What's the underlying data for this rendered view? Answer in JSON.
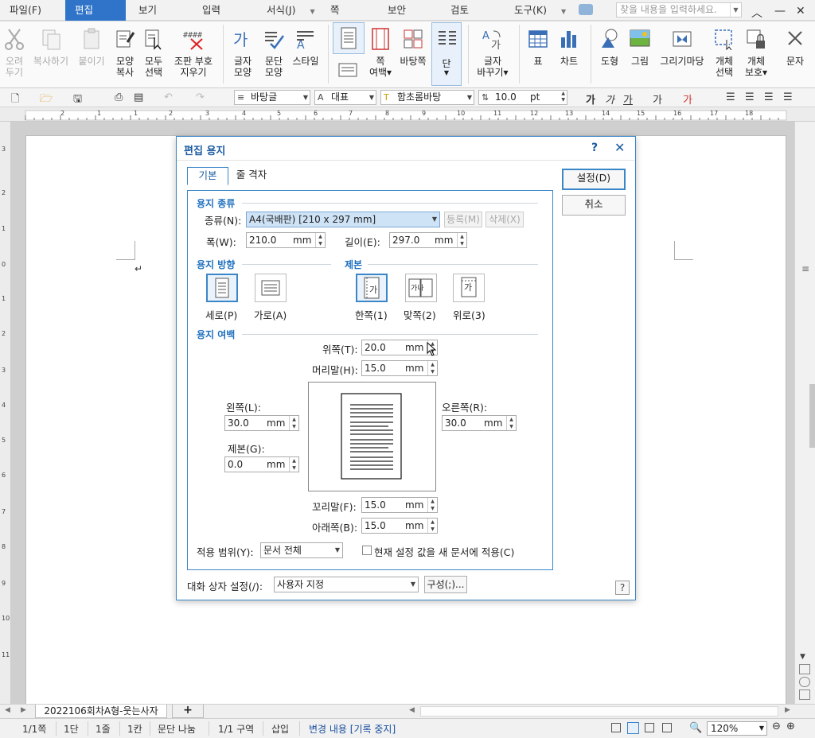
{
  "menubar": {
    "items": [
      {
        "label": "파일(F)"
      },
      {
        "label": "편집(E)"
      },
      {
        "label": "보기(U)"
      },
      {
        "label": "입력(D)"
      },
      {
        "label": "서식(J)"
      },
      {
        "label": "쪽(W)"
      },
      {
        "label": "보안(R)"
      },
      {
        "label": "검토(H)"
      },
      {
        "label": "도구(K)"
      }
    ],
    "search_placeholder": "찾을 내용을 입력하세요."
  },
  "ribbon": {
    "buttons": [
      {
        "label": "오려\n두기"
      },
      {
        "label": "복사하기"
      },
      {
        "label": "붙이기"
      },
      {
        "label": "모양\n복사"
      },
      {
        "label": "모두\n선택"
      },
      {
        "label": "조판 부호\n지우기"
      },
      {
        "label": "글자\n모양"
      },
      {
        "label": "문단\n모양"
      },
      {
        "label": "스타일"
      },
      {
        "label": "쪽\n여백▾"
      },
      {
        "label": "바탕쪽"
      },
      {
        "label": "단"
      },
      {
        "label": "글자\n바꾸기▾"
      },
      {
        "label": "표"
      },
      {
        "label": "차트"
      },
      {
        "label": "도형"
      },
      {
        "label": "그림"
      },
      {
        "label": "그리기마당"
      },
      {
        "label": "개체\n선택"
      },
      {
        "label": "개체\n보호▾"
      },
      {
        "label": "문자"
      }
    ]
  },
  "format": {
    "style": "바탕글",
    "lang": "대표",
    "font": "함초롬바탕",
    "size": "10.0",
    "size_unit": "pt"
  },
  "ruler": {
    "ticks": [
      "2",
      "1",
      "1",
      "2",
      "3",
      "4",
      "5",
      "6",
      "7",
      "8",
      "9",
      "10",
      "11",
      "12",
      "13",
      "14",
      "15",
      "16",
      "17",
      "18"
    ]
  },
  "vruler": {
    "ticks": [
      "3",
      "2",
      "1",
      "0",
      "1",
      "2",
      "3",
      "4",
      "5",
      "6",
      "7",
      "8",
      "9",
      "10",
      "11"
    ]
  },
  "dialog": {
    "title": "편집 용지",
    "help": "?",
    "tabs": [
      "기본",
      "줄 격자"
    ],
    "ok": "설정(D)",
    "cancel": "취소",
    "paper": {
      "section": "용지 종류",
      "kind_label": "종류(N):",
      "kind_value": "A4(국배판)  [210 x 297 mm]",
      "register": "등록(M)",
      "delete": "삭제(X)",
      "width_label": "폭(W):",
      "width_value": "210.0",
      "height_label": "길이(E):",
      "height_value": "297.0",
      "unit": "mm"
    },
    "orientation": {
      "section": "용지 방향",
      "portrait": "세로(P)",
      "landscape": "가로(A)"
    },
    "binding": {
      "section": "제본",
      "single": "한쪽(1)",
      "facing": "맞쪽(2)",
      "top": "위로(3)",
      "icon_single": "가",
      "icon_facing": "가나",
      "icon_top": "가"
    },
    "margins": {
      "section": "용지 여백",
      "top_label": "위쪽(T):",
      "top_value": "20.0",
      "header_label": "머리말(H):",
      "header_value": "15.0",
      "left_label": "왼쪽(L):",
      "left_value": "30.0",
      "gutter_label": "제본(G):",
      "gutter_value": "0.0",
      "right_label": "오른쪽(R):",
      "right_value": "30.0",
      "footer_label": "꼬리말(F):",
      "footer_value": "15.0",
      "bottom_label": "아래쪽(B):",
      "bottom_value": "15.0",
      "unit": "mm"
    },
    "apply_label": "적용 범위(Y):",
    "apply_value": "문서 전체",
    "apply_new_doc": "현재 설정 값을 새 문서에 적용(C)",
    "dlg_setting_label": "대화 상자 설정(/):",
    "dlg_setting_value": "사용자 지정",
    "config_button": "구성(;)..."
  },
  "tabbar": {
    "doc_tab": "2022106회차A형-웃는사자",
    "add": "+"
  },
  "status": {
    "page": "1/1쪽",
    "col": "1단",
    "line": "1줄",
    "char": "1칸",
    "para": "문단 나눔",
    "section": "1/1 구역",
    "insert": "삽입",
    "track": "변경 내용 [기록 중지]",
    "zoom": "120%"
  }
}
